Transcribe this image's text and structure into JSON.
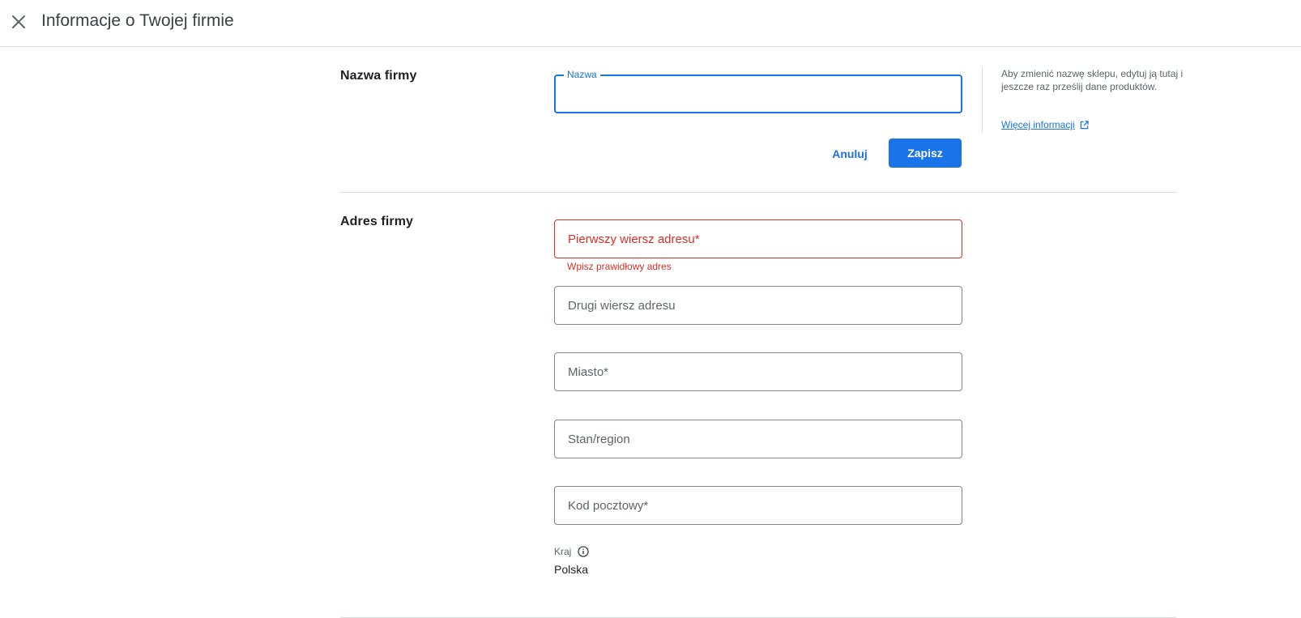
{
  "header": {
    "title": "Informacje o Twojej firmie",
    "close_icon": "close-icon"
  },
  "business_name": {
    "section_label": "Nazwa firmy",
    "field_label": "Nazwa",
    "field_value": "",
    "hint": "Aby zmienić nazwę sklepu, edytuj ją tutaj i jeszcze raz prześlij dane produktów.",
    "more_link": "Więcej informacji",
    "more_link_icon": "external-link-icon",
    "cancel_label": "Anuluj",
    "save_label": "Zapisz"
  },
  "business_address": {
    "section_label": "Adres firmy",
    "address_line1_placeholder": "Pierwszy wiersz adresu*",
    "address_line1_error": "Wpisz prawidłowy adres",
    "address_line2_placeholder": "Drugi wiersz adresu",
    "city_placeholder": "Miasto*",
    "state_placeholder": "Stan/region",
    "postal_code_placeholder": "Kod pocztowy*",
    "country_label": "Kraj",
    "country_info_icon": "info-icon",
    "country_value": "Polska"
  },
  "colors": {
    "accent": "#1a73e8",
    "error": "#d93025",
    "border": "#80868b",
    "divider": "#dadce0"
  }
}
